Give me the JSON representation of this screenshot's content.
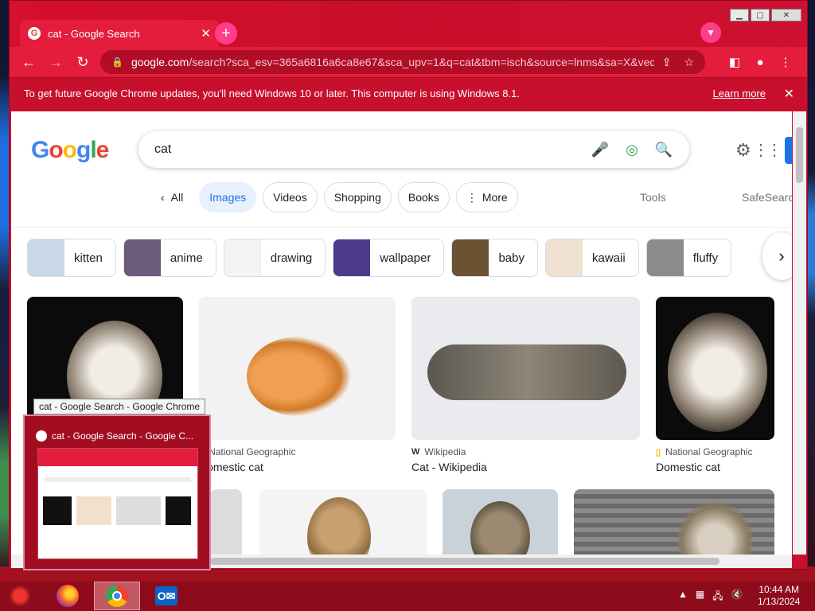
{
  "browser": {
    "tab_title": "cat - Google Search",
    "new_tab_symbol": "+",
    "url_host": "google.com",
    "url_rest": "/search?sca_esv=365a6816a6ca8e67&sca_upv=1&q=cat&tbm=isch&source=lnms&sa=X&ved...",
    "infobar_text": "To get future Google Chrome updates, you'll need Windows 10 or later. This computer is using Windows 8.1.",
    "infobar_link": "Learn more"
  },
  "google": {
    "logo": [
      "G",
      "o",
      "o",
      "g",
      "l",
      "e"
    ],
    "query": "cat",
    "filters": [
      "All",
      "Images",
      "Videos",
      "Shopping",
      "Books",
      "More"
    ],
    "active_filter": "Images",
    "tools": "Tools",
    "safesearch": "SafeSearch"
  },
  "suggestions": [
    {
      "label": "kitten",
      "color": "#c9d7e6"
    },
    {
      "label": "anime",
      "color": "#6b5a7a"
    },
    {
      "label": "drawing",
      "color": "#f4f4f4"
    },
    {
      "label": "wallpaper",
      "color": "#4b3b8a"
    },
    {
      "label": "baby",
      "color": "#6a5232"
    },
    {
      "label": "kawaii",
      "color": "#efe2d2"
    },
    {
      "label": "fluffy",
      "color": "#8b8b8b"
    }
  ],
  "results": [
    {
      "source": "",
      "title": "",
      "bg": "#0b0b0b"
    },
    {
      "source": "National Geographic",
      "title": "Domestic cat",
      "bg": "#f2f2f2"
    },
    {
      "source": "Wikipedia",
      "title": "Cat - Wikipedia",
      "bg": "#e9ebee"
    },
    {
      "source": "National Geographic",
      "title": "Domestic cat",
      "bg": "#0b0b0b"
    }
  ],
  "taskbar": {
    "tooltip": "cat - Google Search - Google Chrome",
    "preview_title": "cat - Google Search - Google C...",
    "time": "10:44 AM",
    "date": "1/13/2024"
  },
  "colors": {
    "chrome_accent": "#e41d3d",
    "google_blue": "#4285f4",
    "active_chip": "#e8f0fe"
  }
}
